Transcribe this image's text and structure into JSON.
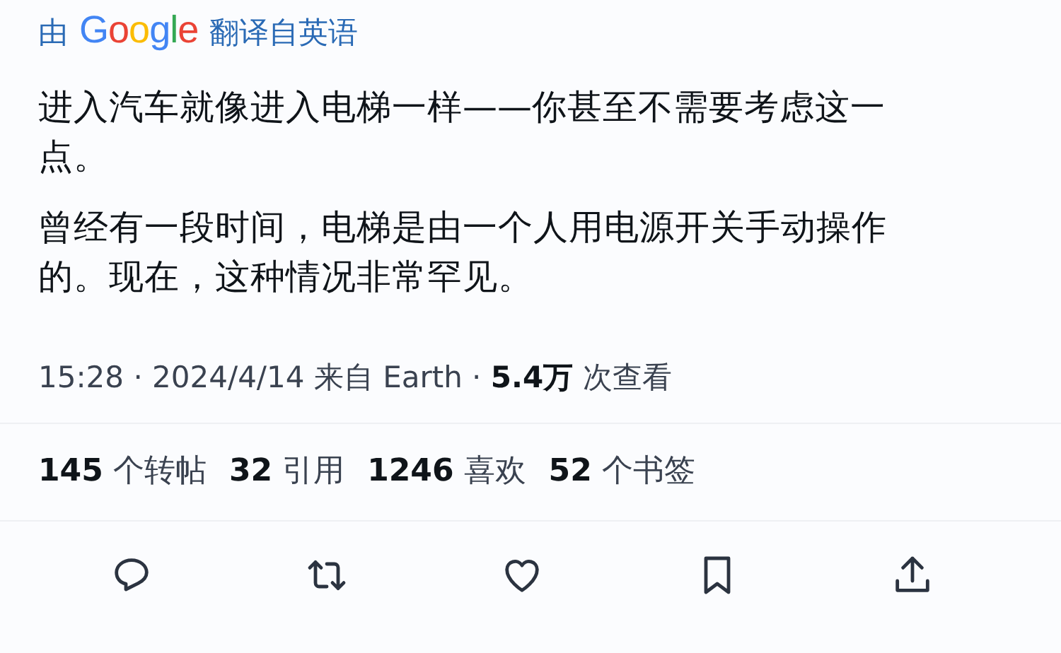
{
  "translation": {
    "prefix": "由",
    "brand": "Google",
    "suffix": "翻译自英语"
  },
  "paragraphs": [
    "进入汽车就像进入电梯一样——你甚至不需要考虑这一点。",
    "曾经有一段时间，电梯是由一个人用电源开关手动操作的。现在，这种情况非常罕见。"
  ],
  "meta": "15:28 · 2024/4/14 来自 Earth · **5.4万** 次查看",
  "stats": [
    "**145** 个转帖",
    "**32** 引用",
    "**1246** 喜欢",
    "**52** 个书签"
  ],
  "actions": [
    {
      "kind": "reply"
    },
    {
      "kind": "repost"
    },
    {
      "kind": "like"
    },
    {
      "kind": "bookmark"
    },
    {
      "kind": "share"
    }
  ]
}
